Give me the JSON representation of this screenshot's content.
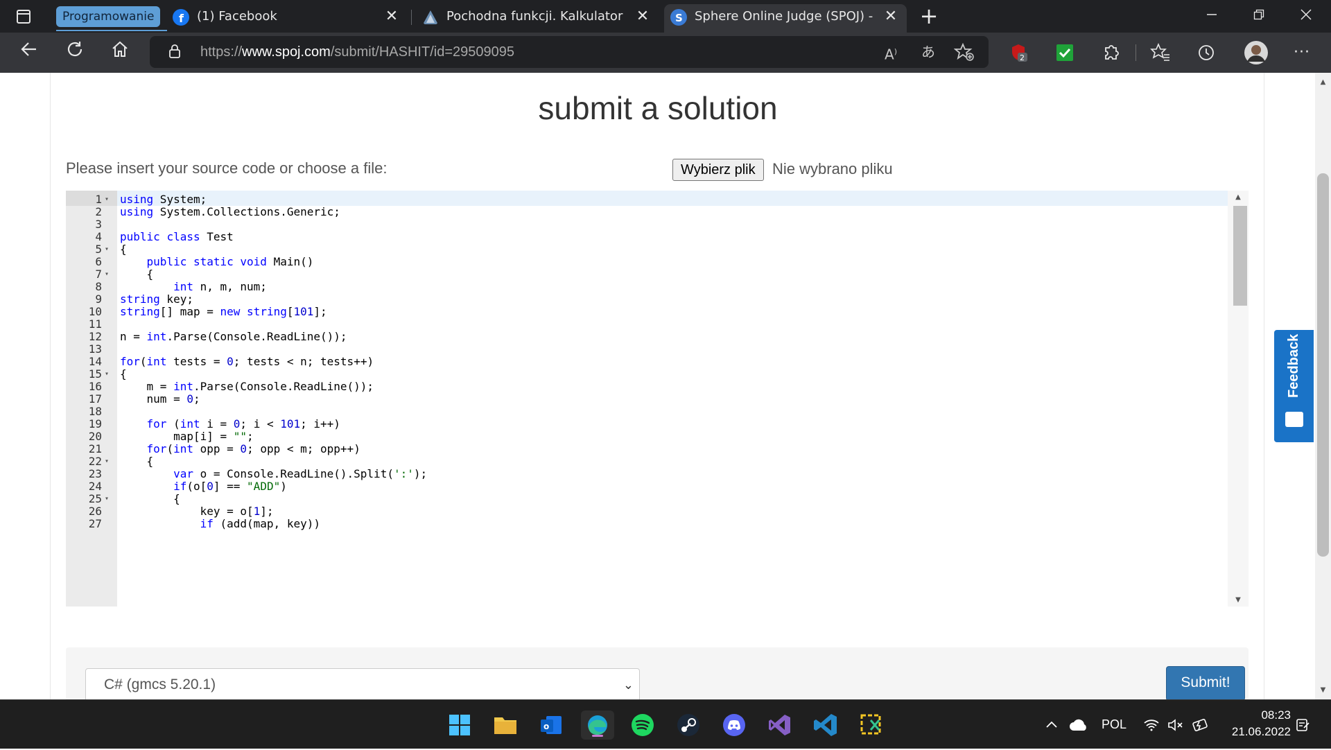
{
  "browser": {
    "tab_group": "Programowanie",
    "tabs": [
      {
        "title": "(1) Facebook",
        "close": "✕"
      },
      {
        "title": "Pochodna funkcji. Kalkulator krok",
        "close": "✕"
      },
      {
        "title": "Sphere Online Judge (SPOJ) - Su",
        "close": "✕"
      }
    ],
    "new_tab": "+",
    "url_prefix": "https://",
    "url_domain": "www.spoj.com",
    "url_path": "/submit/HASHIT/id=29509095",
    "profile_badge": "2"
  },
  "page": {
    "title": "submit a solution",
    "insert_label": "Please insert your source code or choose a file:",
    "file_button": "Wybierz plik",
    "file_none": "Nie wybrano pliku",
    "language_selected": "C# (gmcs 5.20.1)",
    "submit_label": "Submit!",
    "feedback_label": "Feedback"
  },
  "editor": {
    "lines": [
      {
        "n": "1",
        "fold": true,
        "html": "<span class=\"kw\">using</span> System;"
      },
      {
        "n": "2",
        "fold": false,
        "html": "<span class=\"kw\">using</span> System.Collections.Generic;"
      },
      {
        "n": "3",
        "fold": false,
        "html": ""
      },
      {
        "n": "4",
        "fold": false,
        "html": "<span class=\"kw\">public</span> <span class=\"kw\">class</span> Test"
      },
      {
        "n": "5",
        "fold": true,
        "html": "{"
      },
      {
        "n": "6",
        "fold": false,
        "html": "    <span class=\"kw\">public</span> <span class=\"kw\">static</span> <span class=\"kw\">void</span> Main()"
      },
      {
        "n": "7",
        "fold": true,
        "html": "    {"
      },
      {
        "n": "8",
        "fold": false,
        "html": "        <span class=\"kw\">int</span> n, m, num;"
      },
      {
        "n": "9",
        "fold": false,
        "html": "<span class=\"kw\">string</span> key;"
      },
      {
        "n": "10",
        "fold": false,
        "html": "<span class=\"kw\">string</span>[] map = <span class=\"kw\">new</span> <span class=\"kw\">string</span>[<span class=\"num\">101</span>];"
      },
      {
        "n": "11",
        "fold": false,
        "html": ""
      },
      {
        "n": "12",
        "fold": false,
        "html": "n = <span class=\"kw\">int</span>.Parse(Console.ReadLine());"
      },
      {
        "n": "13",
        "fold": false,
        "html": ""
      },
      {
        "n": "14",
        "fold": false,
        "html": "<span class=\"kw\">for</span>(<span class=\"kw\">int</span> tests = <span class=\"num\">0</span>; tests &lt; n; tests++)"
      },
      {
        "n": "15",
        "fold": true,
        "html": "{"
      },
      {
        "n": "16",
        "fold": false,
        "html": "    m = <span class=\"kw\">int</span>.Parse(Console.ReadLine());"
      },
      {
        "n": "17",
        "fold": false,
        "html": "    num = <span class=\"num\">0</span>;"
      },
      {
        "n": "18",
        "fold": false,
        "html": ""
      },
      {
        "n": "19",
        "fold": false,
        "html": "    <span class=\"kw\">for</span> (<span class=\"kw\">int</span> i = <span class=\"num\">0</span>; i &lt; <span class=\"num\">101</span>; i++)"
      },
      {
        "n": "20",
        "fold": false,
        "html": "        map[i] = <span class=\"str\">\"\"</span>;"
      },
      {
        "n": "21",
        "fold": false,
        "html": "    <span class=\"kw\">for</span>(<span class=\"kw\">int</span> opp = <span class=\"num\">0</span>; opp &lt; m; opp++)"
      },
      {
        "n": "22",
        "fold": true,
        "html": "    {"
      },
      {
        "n": "23",
        "fold": false,
        "html": "        <span class=\"kw\">var</span> o = Console.ReadLine().Split(<span class=\"str\">':'</span>);"
      },
      {
        "n": "24",
        "fold": false,
        "html": "        <span class=\"kw\">if</span>(o[<span class=\"num\">0</span>] == <span class=\"str\">\"ADD\"</span>)"
      },
      {
        "n": "25",
        "fold": true,
        "html": "        {"
      },
      {
        "n": "26",
        "fold": false,
        "html": "            key = o[<span class=\"num\">1</span>];"
      },
      {
        "n": "27",
        "fold": false,
        "html": "            <span class=\"kw\">if</span> (add(map, key))"
      }
    ]
  },
  "taskbar": {
    "tray_lang": "POL",
    "time": "08:23",
    "date": "21.06.2022"
  },
  "colors": {
    "accent": "#3276b1",
    "keyword": "#0000ff",
    "feedback": "#1a73c7"
  }
}
